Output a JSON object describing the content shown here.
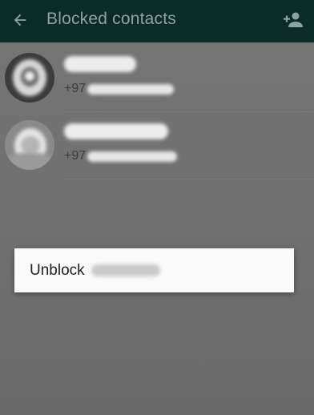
{
  "appbar": {
    "title": "Blocked contacts",
    "back_icon": "arrow-left-icon",
    "add_icon": "add-contact-icon",
    "background_color": "#0b2b27",
    "title_color": "#8fa3a0"
  },
  "contacts": [
    {
      "number_prefix": "+97"
    },
    {
      "number_prefix": "+97"
    }
  ],
  "context_menu": {
    "item_label": "Unblock"
  }
}
